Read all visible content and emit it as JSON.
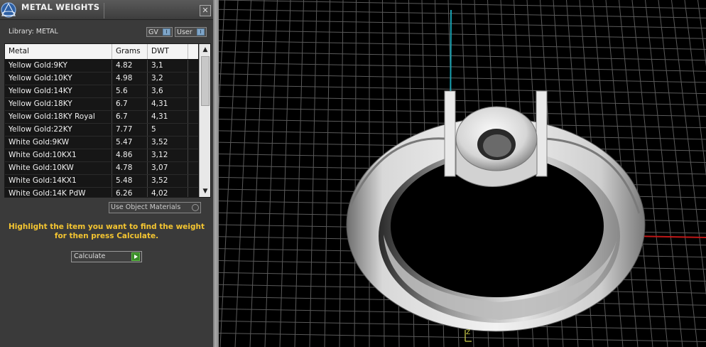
{
  "panel": {
    "title": "METAL WEIGHTS",
    "close_glyph": "✕",
    "library_label": "Library: METAL",
    "library_buttons": [
      {
        "label": "GV",
        "icon": "toggle-indicator"
      },
      {
        "label": "User",
        "icon": "toggle-indicator"
      }
    ],
    "table": {
      "columns": [
        "Metal",
        "Grams",
        "DWT"
      ],
      "rows": [
        [
          "Yellow Gold:9KY",
          "4.82",
          "3,1"
        ],
        [
          "Yellow Gold:10KY",
          "4.98",
          "3,2"
        ],
        [
          "Yellow Gold:14KY",
          "5.6",
          "3,6"
        ],
        [
          "Yellow Gold:18KY",
          "6.7",
          "4,31"
        ],
        [
          "Yellow Gold:18KY Royal",
          "6.7",
          "4,31"
        ],
        [
          "Yellow Gold:22KY",
          "7.77",
          "5"
        ],
        [
          "White Gold:9KW",
          "5.47",
          "3,52"
        ],
        [
          "White Gold:10KX1",
          "4.86",
          "3,12"
        ],
        [
          "White Gold:10KW",
          "4.78",
          "3,07"
        ],
        [
          "White Gold:14KX1",
          "5.48",
          "3,52"
        ],
        [
          "White Gold:14K PdW",
          "6.26",
          "4,02"
        ]
      ],
      "scroll_up_glyph": "▲",
      "scroll_down_glyph": "▼"
    },
    "use_object_materials_label": "Use Object Materials",
    "hint": "Highlight the item you want to find the weight for then press Calculate.",
    "calculate_label": "Calculate"
  },
  "viewport": {
    "axis_label": "Z",
    "colors": {
      "background": "#000000",
      "grid": "#5a5a5a",
      "x_axis": "#c01818",
      "y_axis": "#18a0b0"
    }
  },
  "colors": {
    "hint": "#f4c531",
    "panel_bg": "#3a3a3a",
    "play_button": "#3b8c2a"
  }
}
